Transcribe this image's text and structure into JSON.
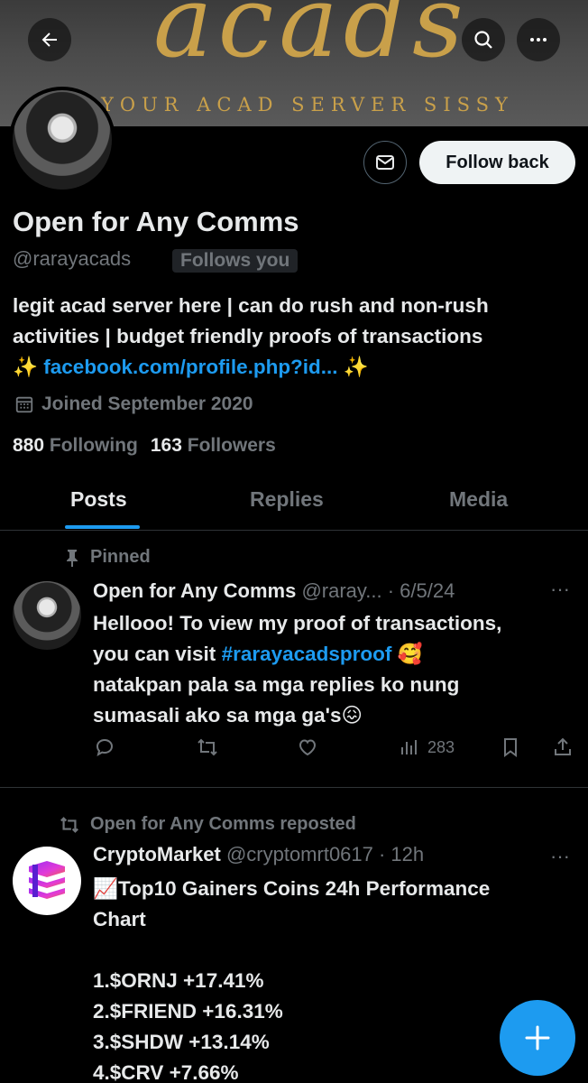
{
  "banner": {
    "script_text": "acads",
    "tagline": "YOUR ACAD SERVER SISSY"
  },
  "header": {
    "back_icon": "back-arrow-icon",
    "search_icon": "search-icon",
    "more_icon": "more-icon"
  },
  "profile": {
    "display_name": "Open for Any Comms",
    "handle": "@rarayacads",
    "follows_you": "Follows you",
    "follow_button": "Follow back",
    "bio_line1": "legit acad server here | can do rush and non-rush",
    "bio_line2": "activities | budget friendly proofs of transactions",
    "bio_sparkle1": "✨",
    "bio_link": "facebook.com/profile.php?id...",
    "bio_sparkle2": "✨",
    "joined": "Joined September 2020",
    "following_count": "880",
    "following_label": "Following",
    "followers_count": "163",
    "followers_label": "Followers"
  },
  "tabs": [
    {
      "label": "Posts",
      "active": true
    },
    {
      "label": "Replies",
      "active": false
    },
    {
      "label": "Media",
      "active": false
    }
  ],
  "pinned_post": {
    "pinned_label": "Pinned",
    "author": "Open for Any Comms",
    "handle_meta": "@raray... · 6/5/24",
    "text_1": "Hellooo! To view my proof of transactions,",
    "text_2a": "you can visit ",
    "hashtag": "#rarayacadsproof",
    "emoji_1": " 🥰",
    "text_3": "natakpan pala sa mga replies ko nung",
    "text_4": "sumasali ako sa mga ga's",
    "emoji_2": "😖",
    "views": "283",
    "more": "···"
  },
  "repost": {
    "repost_label": "Open for Any Comms reposted",
    "author": "CryptoMarket",
    "handle_meta": "@cryptomrt0617 · 12h",
    "emoji": "📈",
    "title_1": "Top10 Gainers Coins 24h Performance",
    "title_2": "Chart",
    "items": [
      "1.$ORNJ +17.41%",
      "2.$FRIEND +16.31%",
      "3.$SHDW +13.14%",
      "4.$CRV +7.66%"
    ],
    "more": "···"
  },
  "fab": {
    "label": "+"
  },
  "colors": {
    "accent": "#1d9bf0",
    "muted": "#71767b",
    "text": "#e7e9ea",
    "banner_gold": "#c9a04a"
  }
}
